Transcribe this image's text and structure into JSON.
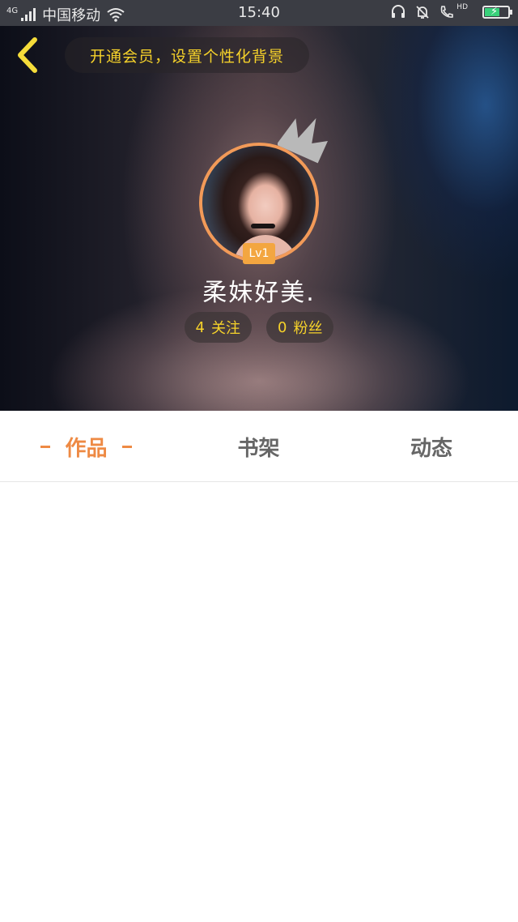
{
  "status_bar": {
    "network_type": "4G",
    "carrier": "中国移动",
    "time": "15:40",
    "hd_label": "HD",
    "battery_color": "#39d07a"
  },
  "header": {
    "back_icon": "chevron-left-icon",
    "vip_banner": "开通会员，设置个性化背景"
  },
  "profile": {
    "level": "Lv1",
    "nickname": "柔妹好美.",
    "following_count": "4",
    "following_label": "关注",
    "followers_count": "0",
    "followers_label": "粉丝"
  },
  "tabs": {
    "works": "作品",
    "bookshelf": "书架",
    "feed": "动态",
    "active": "works",
    "active_color": "#ee8a44"
  }
}
